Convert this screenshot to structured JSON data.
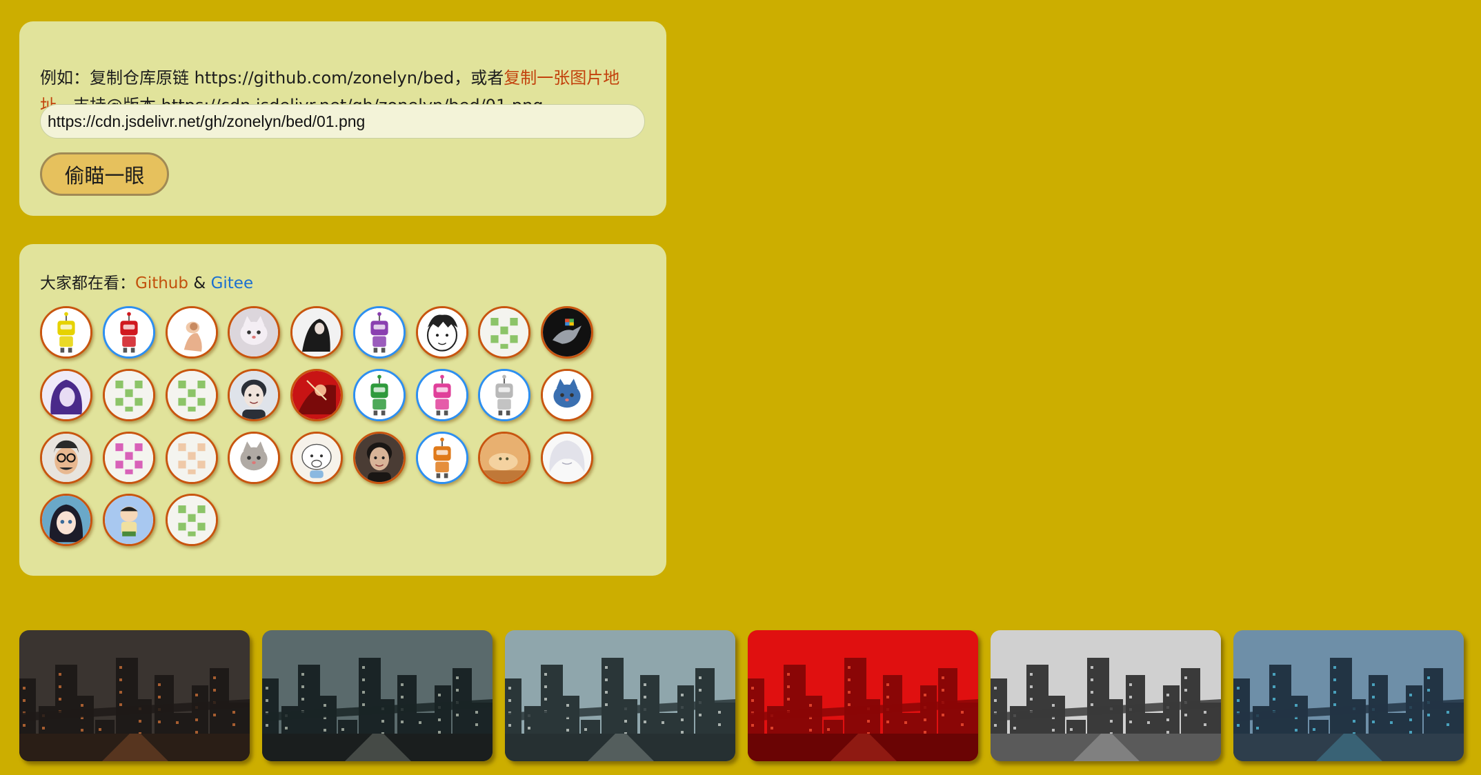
{
  "form": {
    "hint_prefix": "例如：复制仓库原链 https://github.com/zonelyn/bed，或者",
    "hint_link": "复制一张图片地址",
    "hint_suffix": "，支持@版本 https://cdn.jsdelivr.net/gh/zonelyn/bed/01.png",
    "input_value": "https://cdn.jsdelivr.net/gh/zonelyn/bed/01.png",
    "button_label": "偷瞄一眼"
  },
  "watching": {
    "prefix": "大家都在看：",
    "github_label": "Github",
    "amp": "&",
    "gitee_label": "Gitee"
  },
  "avatars": [
    {
      "icon": "yellow-robot-icon",
      "ring": "orange"
    },
    {
      "icon": "red-robot-icon",
      "ring": "blue"
    },
    {
      "icon": "figure-sketch-icon",
      "ring": "orange"
    },
    {
      "icon": "white-cat-icon",
      "ring": "orange"
    },
    {
      "icon": "dark-figure-icon",
      "ring": "orange"
    },
    {
      "icon": "purple-robot-icon",
      "ring": "blue"
    },
    {
      "icon": "cartoon-face-icon",
      "ring": "orange"
    },
    {
      "icon": "green-identicon-icon",
      "ring": "orange"
    },
    {
      "icon": "bird-dark-icon",
      "ring": "orange"
    },
    {
      "icon": "anime-purple-icon",
      "ring": "orange"
    },
    {
      "icon": "green-identicon-icon",
      "ring": "orange"
    },
    {
      "icon": "green-identicon-icon",
      "ring": "orange"
    },
    {
      "icon": "portrait-icon",
      "ring": "orange"
    },
    {
      "icon": "red-art-icon",
      "ring": "orange"
    },
    {
      "icon": "green-robot-icon",
      "ring": "blue"
    },
    {
      "icon": "pink-robot-icon",
      "ring": "blue"
    },
    {
      "icon": "grey-robot-icon",
      "ring": "blue"
    },
    {
      "icon": "blue-cat-icon",
      "ring": "orange"
    },
    {
      "icon": "glasses-man-icon",
      "ring": "orange"
    },
    {
      "icon": "pink-identicon-icon",
      "ring": "orange"
    },
    {
      "icon": "peach-identicon-icon",
      "ring": "orange"
    },
    {
      "icon": "grey-cat-icon",
      "ring": "orange"
    },
    {
      "icon": "cartoon-baby-icon",
      "ring": "orange"
    },
    {
      "icon": "man-photo-icon",
      "ring": "orange"
    },
    {
      "icon": "orange-robot-icon",
      "ring": "blue"
    },
    {
      "icon": "bread-icon",
      "ring": "orange"
    },
    {
      "icon": "white-hair-icon",
      "ring": "orange"
    },
    {
      "icon": "anime-girl-icon",
      "ring": "orange"
    },
    {
      "icon": "blue-boy-icon",
      "ring": "orange"
    },
    {
      "icon": "green-identicon-icon",
      "ring": "orange"
    }
  ],
  "gallery": [
    {
      "icon": "city-night-image"
    },
    {
      "icon": "city-dusk-image"
    },
    {
      "icon": "city-day-image"
    },
    {
      "icon": "city-red-image"
    },
    {
      "icon": "city-grey-image"
    },
    {
      "icon": "city-street-image"
    }
  ],
  "colors": {
    "background": "#ccae00",
    "panel": "#e1e39b",
    "link_orange": "#c2410c",
    "link_blue": "#1a6fd1",
    "button": "#e6c15d"
  }
}
